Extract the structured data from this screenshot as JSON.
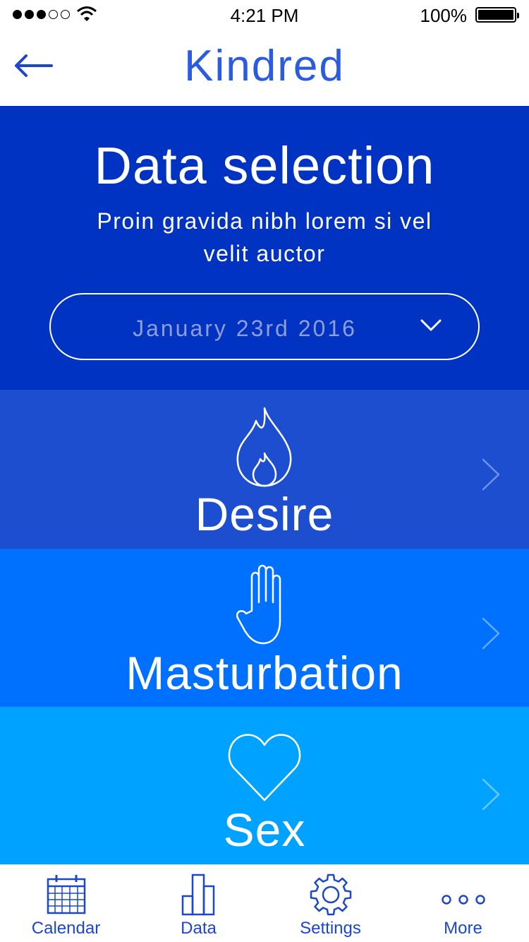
{
  "status_bar": {
    "time": "4:21 PM",
    "battery": "100%",
    "signal_strength": 3
  },
  "nav": {
    "title": "Kindred",
    "back_icon": "arrow-left-icon"
  },
  "hero": {
    "title": "Data selection",
    "subtitle": "Proin gravida nibh lorem si vel velit auctor",
    "date_value": "January 23rd 2016"
  },
  "categories": [
    {
      "label": "Desire",
      "icon": "flame-icon"
    },
    {
      "label": "Masturbation",
      "icon": "hand-icon"
    },
    {
      "label": "Sex",
      "icon": "heart-icon"
    }
  ],
  "tabs": [
    {
      "label": "Calendar",
      "icon": "calendar-icon"
    },
    {
      "label": "Data",
      "icon": "bar-chart-icon"
    },
    {
      "label": "Settings",
      "icon": "gear-icon"
    },
    {
      "label": "More",
      "icon": "more-dots-icon"
    }
  ],
  "colors": {
    "brand": "#2a5be0",
    "hero_bg": "#0033c2",
    "desire_bg": "#1c4ecf",
    "masturbation_bg": "#0070ff",
    "sex_bg": "#00a2ff",
    "tab_color": "#1c47c8"
  }
}
